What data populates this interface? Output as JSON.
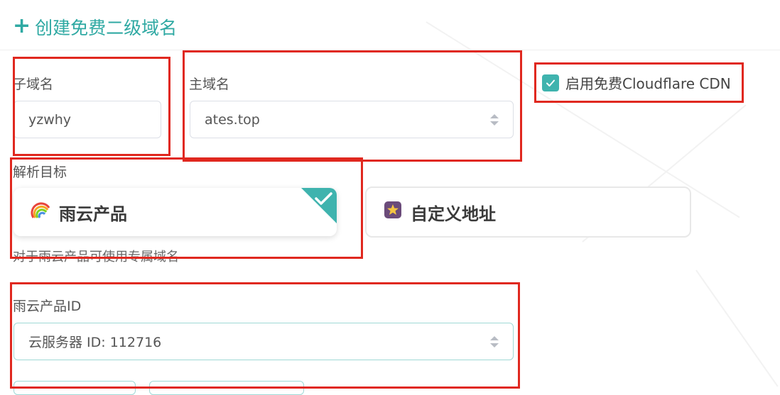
{
  "page": {
    "title": "创建免费二级域名",
    "add_icon": "plus-icon",
    "accent_color": "#2fa9a3",
    "highlight_color": "#e0281f"
  },
  "subdomain": {
    "label": "子域名",
    "value": "yzwhy"
  },
  "main_domain": {
    "label": "主域名",
    "value": "ates.top"
  },
  "cdn": {
    "label": "启用免费Cloudflare CDN",
    "checked": true
  },
  "target": {
    "label": "解析目标",
    "options": [
      {
        "label": "雨云产品",
        "icon": "rainbow-icon",
        "selected": true
      },
      {
        "label": "自定义地址",
        "icon": "star-badge-icon",
        "selected": false
      }
    ],
    "hint": "对于雨云产品可使用专属域名"
  },
  "product": {
    "label": "雨云产品ID",
    "value": "云服务器 ID: 112716"
  }
}
